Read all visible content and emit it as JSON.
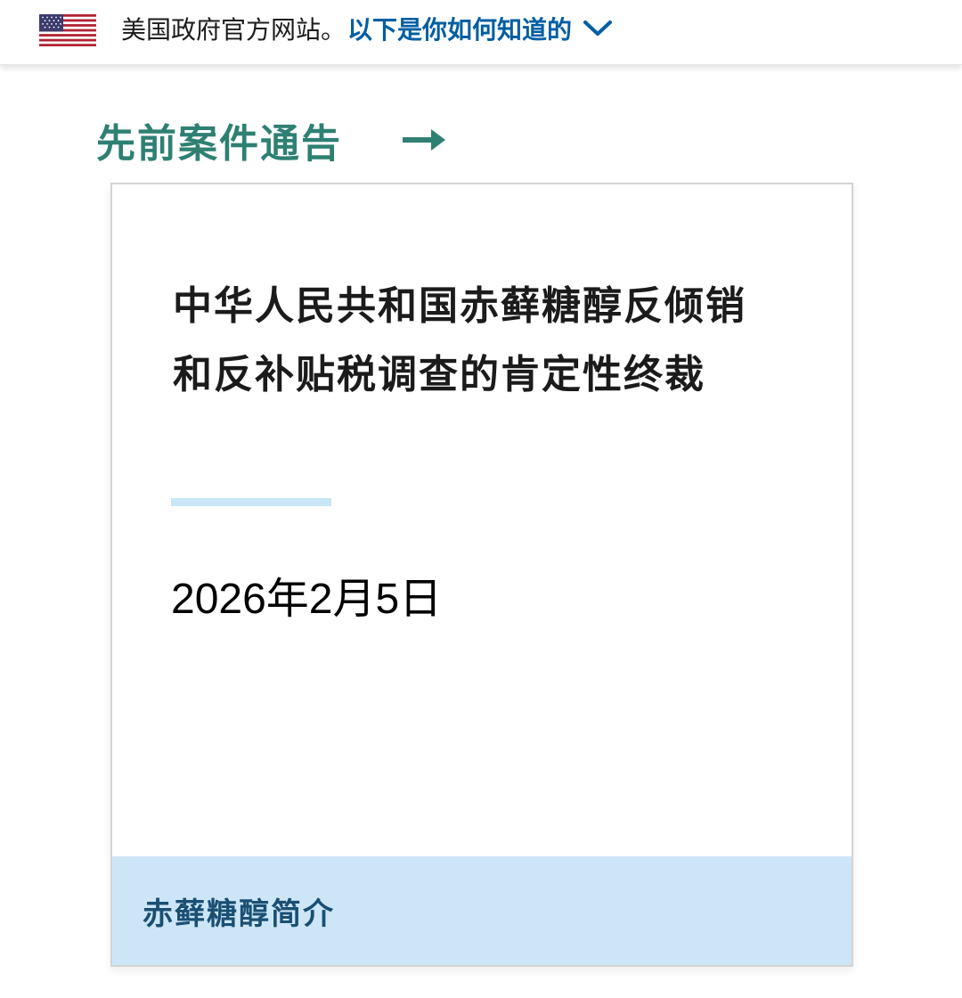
{
  "banner": {
    "flag_icon": "us-flag-icon",
    "text": "美国政府官方网站。",
    "link_label": "以下是你如何知道的",
    "chevron_icon": "chevron-down-icon",
    "link_color": "#005ea2"
  },
  "section": {
    "title": "先前案件通告",
    "arrow_icon": "arrow-right-icon",
    "title_color": "#2e8073"
  },
  "card": {
    "title": "中华人民共和国赤藓糖醇反倾销和反补贴税调查的肯定性终裁",
    "date": "2026年2月5日",
    "footer_label": "赤藓糖醇简介",
    "accent_color": "#c8e6f5",
    "footer_bg": "#cde6f7"
  }
}
